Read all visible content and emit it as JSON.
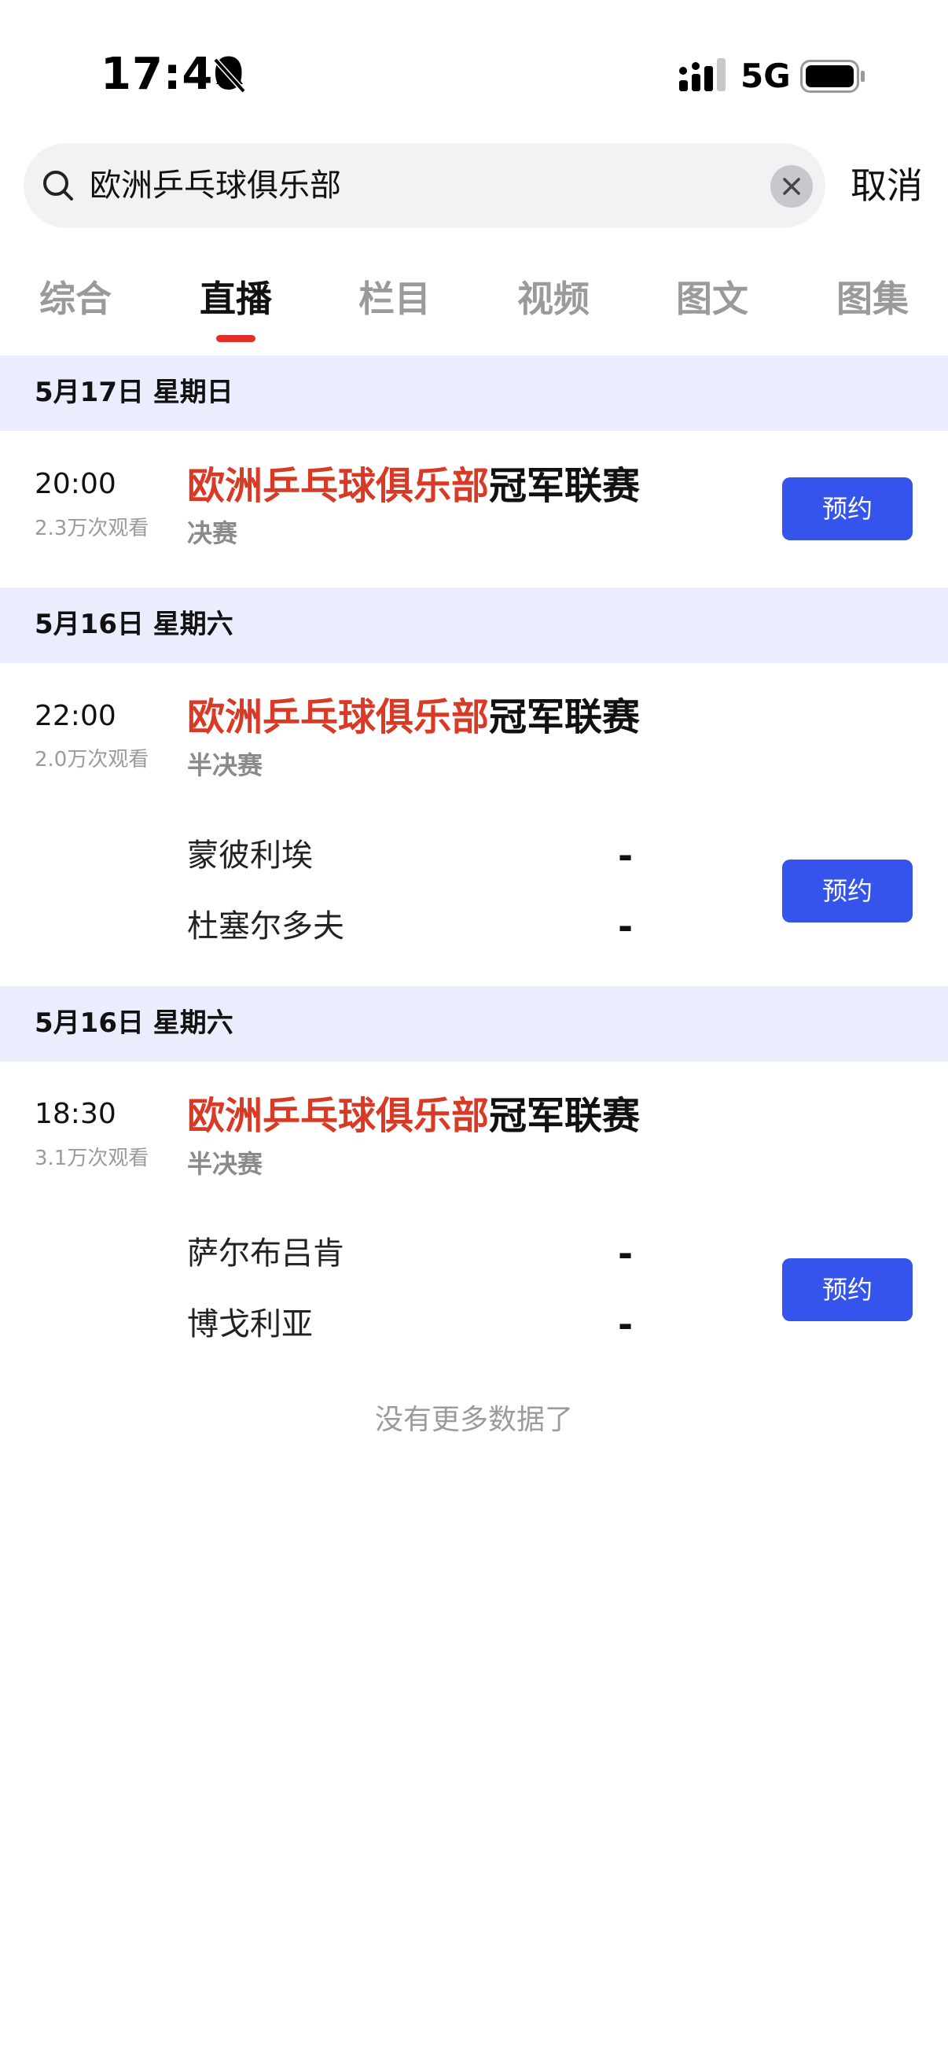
{
  "status_bar": {
    "time": "17:40",
    "network": "5G"
  },
  "search": {
    "query": "欧洲乒乓球俱乐部",
    "cancel_label": "取消"
  },
  "tabs": [
    {
      "label": "综合"
    },
    {
      "label": "直播"
    },
    {
      "label": "栏目"
    },
    {
      "label": "视频"
    },
    {
      "label": "图文"
    },
    {
      "label": "图集"
    }
  ],
  "active_tab": "直播",
  "sections": [
    {
      "date": "5月17日  星期日",
      "event": {
        "time": "20:00",
        "views": "2.3万次观看",
        "title_highlight": "欧洲乒乓球俱乐部",
        "title_rest": "冠军联赛",
        "stage": "决赛",
        "button": "预约"
      }
    },
    {
      "date": "5月16日  星期六",
      "event": {
        "time": "22:00",
        "views": "2.0万次观看",
        "title_highlight": "欧洲乒乓球俱乐部",
        "title_rest": "冠军联赛",
        "stage": "半决赛",
        "teams": [
          {
            "name": "蒙彼利埃",
            "score": "-"
          },
          {
            "name": "杜塞尔多夫",
            "score": "-"
          }
        ],
        "button": "预约"
      }
    },
    {
      "date": "5月16日  星期六",
      "event": {
        "time": "18:30",
        "views": "3.1万次观看",
        "title_highlight": "欧洲乒乓球俱乐部",
        "title_rest": "冠军联赛",
        "stage": "半决赛",
        "teams": [
          {
            "name": "萨尔布吕肯",
            "score": "-"
          },
          {
            "name": "博戈利亚",
            "score": "-"
          }
        ],
        "button": "预约"
      }
    }
  ],
  "footer": {
    "no_more": "没有更多数据了"
  },
  "colors": {
    "accent_blue": "#3554ec",
    "highlight_red": "#d93a26",
    "tab_indicator": "#e23028",
    "date_header_bg": "#e9edfd"
  },
  "icons": [
    "bell-muted-icon",
    "cellular-signal-icon",
    "battery-icon",
    "search-icon",
    "clear-icon"
  ]
}
